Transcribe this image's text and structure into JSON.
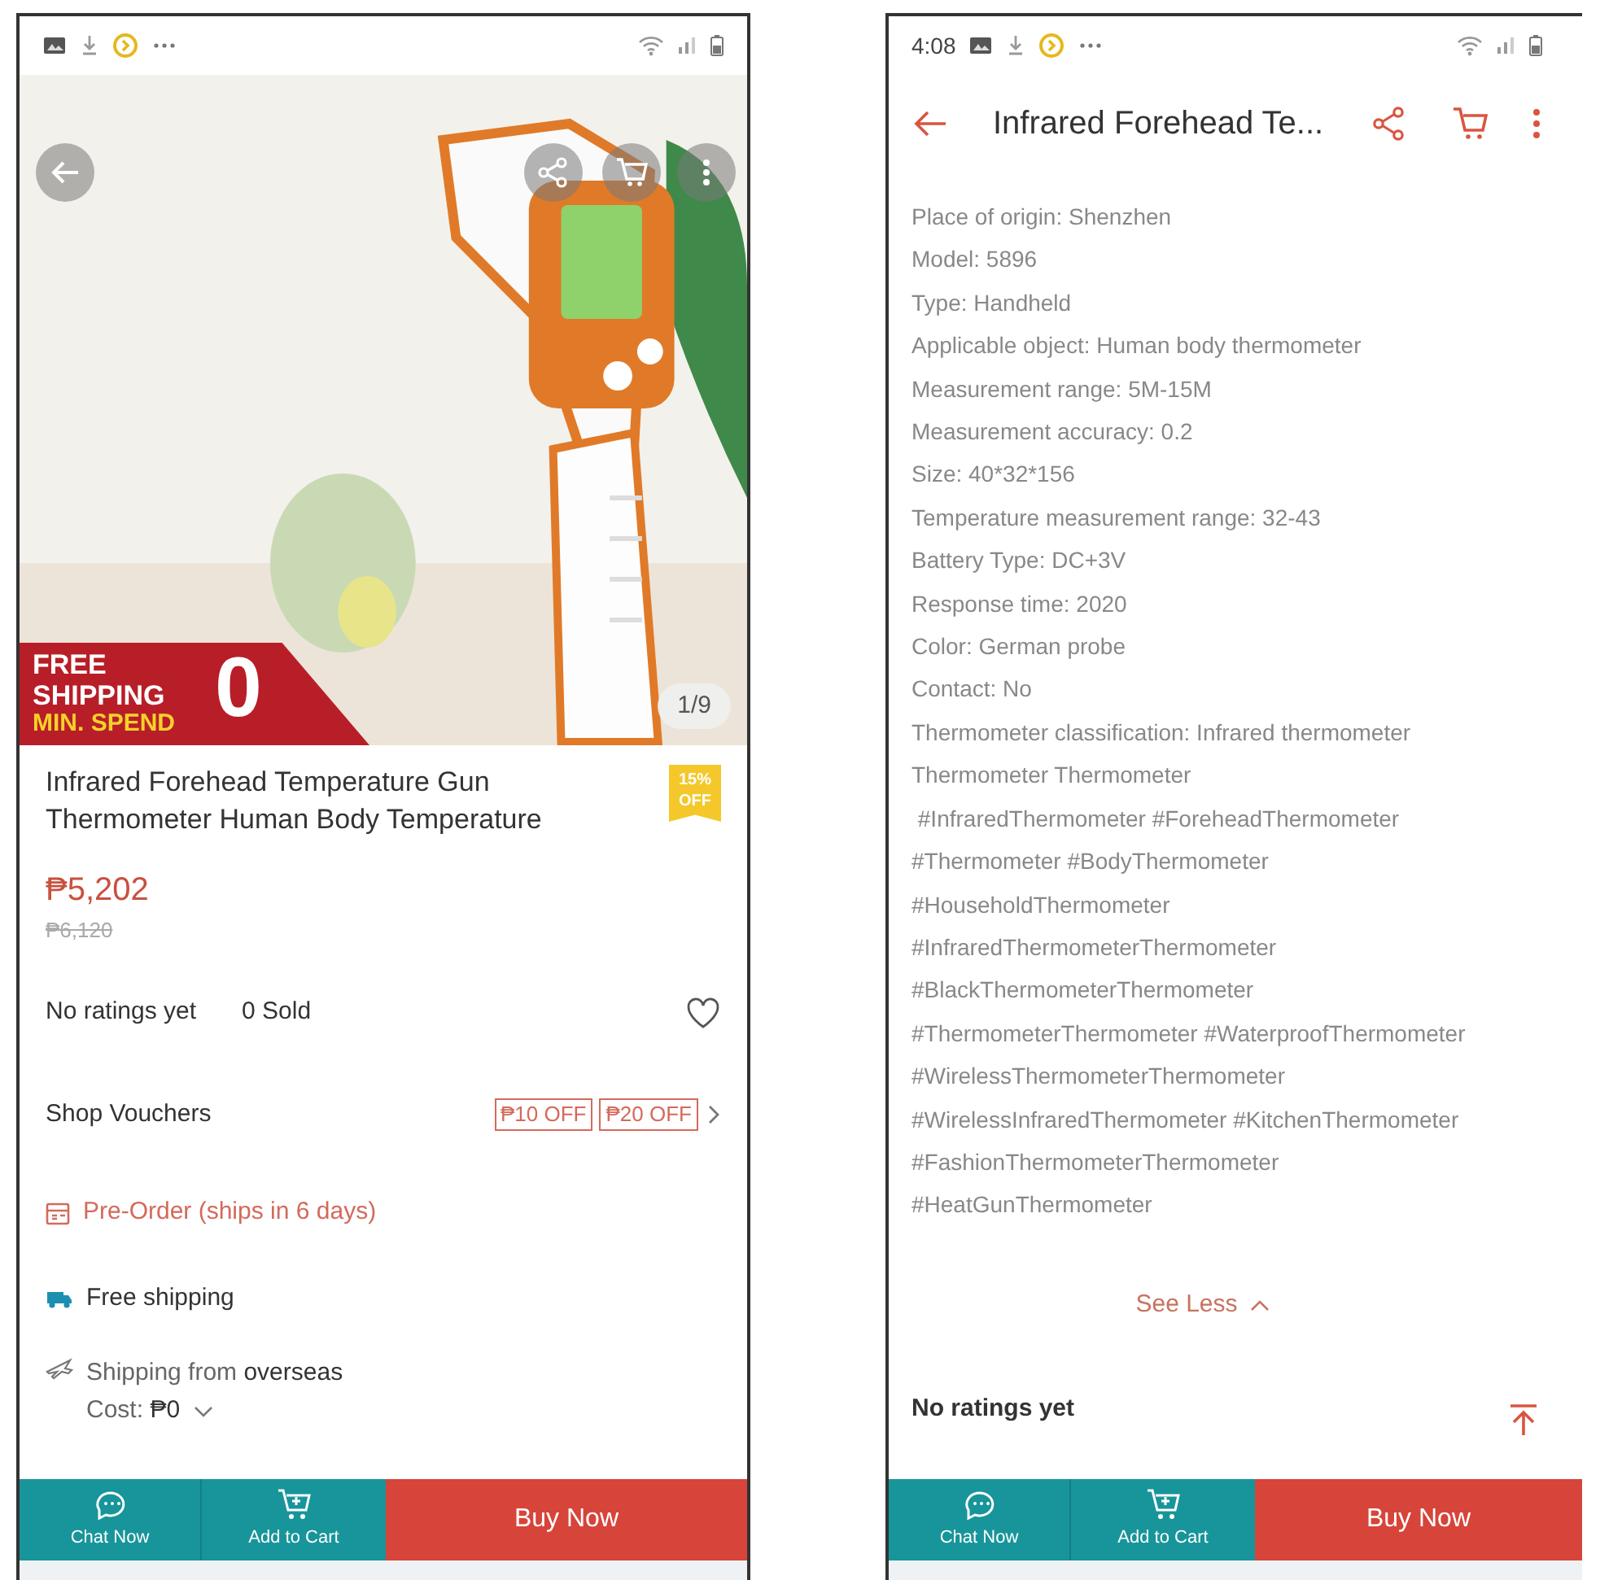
{
  "product_screen": {
    "image": {
      "kind": "picture",
      "counter": "1/9"
    },
    "promo_banner": {
      "line_1": "FREE",
      "line_2": "SHIPPING",
      "line_3": "MIN. SPEND",
      "amount": "0"
    },
    "title": "Infrared Forehead Temperature Gun Thermometer Human Body Temperature",
    "discount_badge": "15% OFF",
    "price": "₱5,202",
    "original_price": "₱6,120",
    "ratings": "No ratings yet",
    "sold": "0 Sold",
    "favorite": false,
    "shop_vouchers": {
      "label": "Shop Vouchers",
      "vouchers": [
        "₱10 OFF",
        "₱20 OFF"
      ]
    },
    "pre_order": "Pre-Order (ships in 6 days)",
    "free_shipping": "Free shipping",
    "shipping_from": {
      "prefix": "Shipping from ",
      "origin": "overseas",
      "cost_label": "Cost: ",
      "cost": "₱0"
    },
    "actions": [
      {
        "kind": "chat",
        "label": "Chat Now"
      },
      {
        "kind": "cart",
        "label": "Add to Cart"
      },
      {
        "kind": "buy",
        "label": "Buy Now"
      }
    ]
  },
  "details_screen": {
    "status_bar": {
      "time": "4:08"
    },
    "header": {
      "title": "Infrared Forehead Te..."
    },
    "specs": [
      "Place of origin: Shenzhen",
      "Model: 5896",
      "Type: Handheld",
      "Applicable object: Human body thermometer",
      "Measurement range: 5M-15M",
      "Measurement accuracy: 0.2",
      "Size: 40*32*156",
      "Temperature measurement range: 32-43",
      "Battery Type: DC+3V",
      "Response time: 2020",
      "Color: German probe",
      "Contact: No",
      "Thermometer classification: Infrared thermometer",
      "Thermometer Thermometer",
      " #InfraredThermometer #ForeheadThermometer",
      "#Thermometer #BodyThermometer",
      "#HouseholdThermometer",
      "#InfraredThermometerThermometer",
      "#BlackThermometerThermometer",
      "#ThermometerThermometer #WaterproofThermometer",
      "#WirelessThermometerThermometer",
      "#WirelessInfraredThermometer #KitchenThermometer",
      "#FashionThermometerThermometer",
      "#HeatGunThermometer"
    ],
    "see_less": "See Less",
    "ratings": "No ratings yet",
    "actions": [
      {
        "kind": "chat",
        "label": "Chat Now"
      },
      {
        "kind": "cart",
        "label": "Add to Cart"
      },
      {
        "kind": "buy",
        "label": "Buy Now"
      }
    ]
  }
}
